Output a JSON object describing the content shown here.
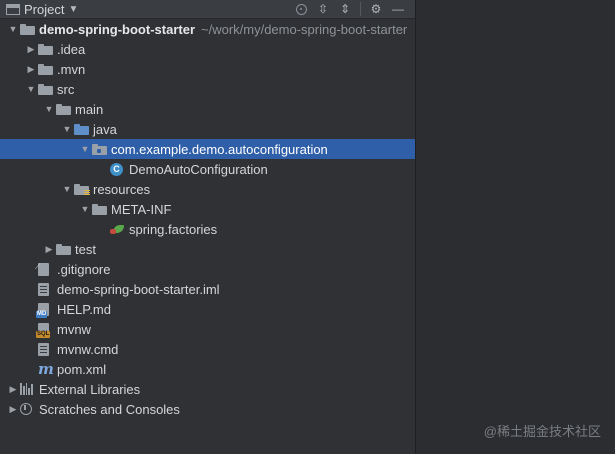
{
  "header": {
    "title": "Project",
    "icons": [
      "project-window-icon",
      "chevron-down-icon",
      "locate-icon",
      "expand-all-icon",
      "collapse-all-icon",
      "gear-icon",
      "hide-icon"
    ]
  },
  "tree": [
    {
      "label": "demo-spring-boot-starter",
      "path": "~/work/my/demo-spring-boot-starter",
      "depth": 0,
      "expanded": true,
      "icon": "folder-icon"
    },
    {
      "label": ".idea",
      "depth": 1,
      "expanded": false,
      "icon": "folder-icon"
    },
    {
      "label": ".mvn",
      "depth": 1,
      "expanded": false,
      "icon": "folder-icon"
    },
    {
      "label": "src",
      "depth": 1,
      "expanded": true,
      "icon": "folder-icon"
    },
    {
      "label": "main",
      "depth": 2,
      "expanded": true,
      "icon": "folder-icon"
    },
    {
      "label": "java",
      "depth": 3,
      "expanded": true,
      "icon": "source-folder-icon"
    },
    {
      "label": "com.example.demo.autoconfiguration",
      "depth": 4,
      "expanded": true,
      "icon": "package-icon",
      "selected": true
    },
    {
      "label": "DemoAutoConfiguration",
      "depth": 5,
      "icon": "class-icon"
    },
    {
      "label": "resources",
      "depth": 3,
      "expanded": true,
      "icon": "resources-folder-icon"
    },
    {
      "label": "META-INF",
      "depth": 4,
      "expanded": true,
      "icon": "folder-icon"
    },
    {
      "label": "spring.factories",
      "depth": 5,
      "icon": "spring-icon"
    },
    {
      "label": "test",
      "depth": 2,
      "expanded": false,
      "icon": "folder-icon"
    },
    {
      "label": ".gitignore",
      "depth": 1,
      "icon": "gitignore-icon"
    },
    {
      "label": "demo-spring-boot-starter.iml",
      "depth": 1,
      "icon": "iml-file-icon"
    },
    {
      "label": "HELP.md",
      "depth": 1,
      "icon": "markdown-icon"
    },
    {
      "label": "mvnw",
      "depth": 1,
      "icon": "script-file-icon"
    },
    {
      "label": "mvnw.cmd",
      "depth": 1,
      "icon": "text-file-icon"
    },
    {
      "label": "pom.xml",
      "depth": 1,
      "icon": "maven-icon"
    },
    {
      "label": "External Libraries",
      "depth": 0,
      "expanded": false,
      "icon": "libraries-icon"
    },
    {
      "label": "Scratches and Consoles",
      "depth": 0,
      "expanded": false,
      "icon": "scratches-icon"
    }
  ],
  "watermark": "@稀土掘金技术社区",
  "colors": {
    "selection": "#2f5fa8",
    "panel": "#2f3134",
    "folder": "#9aa0a7",
    "source_folder": "#5e8fc9"
  }
}
